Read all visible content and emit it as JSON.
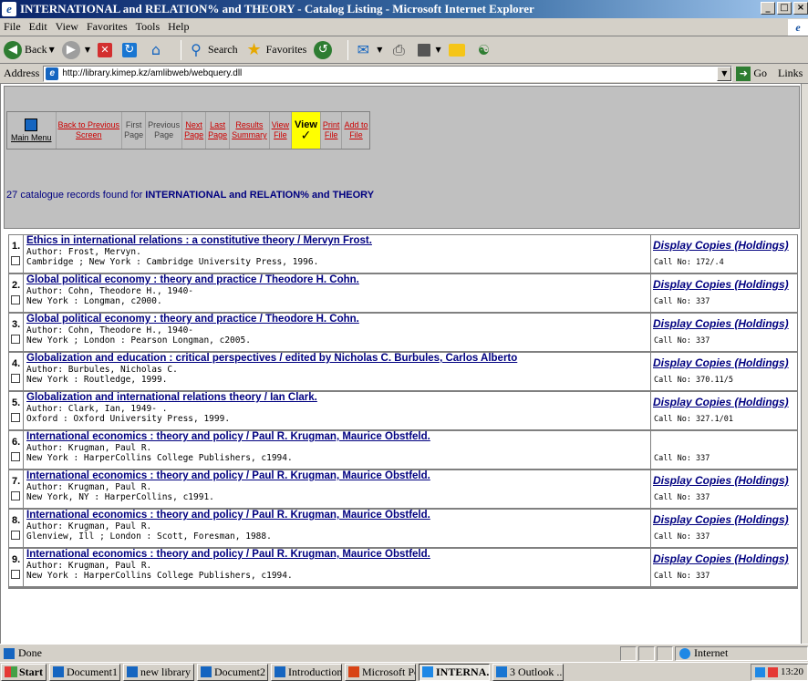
{
  "window": {
    "title": "INTERNATIONAL and RELATION% and THEORY - Catalog Listing - Microsoft Internet Explorer",
    "controls": [
      "_",
      "□",
      "×"
    ]
  },
  "menu": [
    "File",
    "Edit",
    "View",
    "Favorites",
    "Tools",
    "Help"
  ],
  "toolbar": {
    "back": "Back",
    "search": "Search",
    "favorites": "Favorites"
  },
  "address": {
    "label": "Address",
    "url": "http://library.kimep.kz/amlibweb/webquery.dll",
    "go": "Go",
    "links": "Links"
  },
  "nav": {
    "main_menu": "Main Menu",
    "back_previous": [
      "Back to Previous",
      "Screen"
    ],
    "first_page": [
      "First",
      "Page"
    ],
    "previous_page": [
      "Previous",
      "Page"
    ],
    "next_page": [
      "Next",
      "Page"
    ],
    "last_page": [
      "Last",
      "Page"
    ],
    "results_summary": [
      "Results",
      "Summary"
    ],
    "view_file": [
      "View",
      "File"
    ],
    "view_big": "View",
    "print_file": [
      "Print",
      "File"
    ],
    "add_to_file": [
      "Add to",
      "File"
    ]
  },
  "search": {
    "count": "27",
    "found_text": "catalogue records found for",
    "query": "INTERNATIONAL and RELATION% and THEORY"
  },
  "results": [
    {
      "num": "1.",
      "title": "Ethics in international relations : a constitutive theory / Mervyn Frost.",
      "author": "Author: Frost, Mervyn.",
      "pub": "Cambridge ; New York : Cambridge University Press, 1996.",
      "holdings": "Display Copies (Holdings)",
      "call": "Call No: 172/.4"
    },
    {
      "num": "2.",
      "title": "Global political economy : theory and practice / Theodore H. Cohn.",
      "author": "Author: Cohn, Theodore H., 1940-",
      "pub": "New York : Longman, c2000.",
      "holdings": "Display Copies (Holdings)",
      "call": "Call No: 337"
    },
    {
      "num": "3.",
      "title": "Global political economy : theory and practice / Theodore H. Cohn.",
      "author": "Author: Cohn, Theodore H., 1940-",
      "pub": "New York ; London : Pearson Longman, c2005.",
      "holdings": "Display Copies (Holdings)",
      "call": "Call No: 337"
    },
    {
      "num": "4.",
      "title": "Globalization and education : critical perspectives / edited by Nicholas C. Burbules, Carlos Alberto",
      "author": "Author: Burbules, Nicholas C.",
      "pub": "New York : Routledge, 1999.",
      "holdings": "Display Copies (Holdings)",
      "call": "Call No: 370.11/5"
    },
    {
      "num": "5.",
      "title": "Globalization and international relations theory / Ian Clark.",
      "author": "Author: Clark, Ian, 1949- .",
      "pub": "Oxford : Oxford University Press, 1999.",
      "holdings": "Display Copies (Holdings)",
      "call": "Call No: 327.1/01"
    },
    {
      "num": "6.",
      "title": "International economics : theory and policy / Paul R. Krugman, Maurice Obstfeld.",
      "author": "Author: Krugman, Paul R.",
      "pub": "New York : HarperCollins College Publishers, c1994.",
      "holdings": "",
      "call": "Call No: 337"
    },
    {
      "num": "7.",
      "title": "International economics : theory and policy / Paul R. Krugman, Maurice Obstfeld.",
      "author": "Author: Krugman, Paul R.",
      "pub": "New York, NY : HarperCollins, c1991.",
      "holdings": "Display Copies (Holdings)",
      "call": "Call No: 337"
    },
    {
      "num": "8.",
      "title": "International economics : theory and policy / Paul R. Krugman, Maurice Obstfeld.",
      "author": "Author: Krugman, Paul R.",
      "pub": "Glenview, Ill ; London : Scott, Foresman, 1988.",
      "holdings": "Display Copies (Holdings)",
      "call": "Call No: 337"
    },
    {
      "num": "9.",
      "title": "International economics : theory and policy / Paul R. Krugman, Maurice Obstfeld.",
      "author": "Author: Krugman, Paul R.",
      "pub": "New York : HarperCollins College Publishers, c1994.",
      "holdings": "Display Copies (Holdings)",
      "call": "Call No: 337"
    }
  ],
  "status": {
    "text": "Done",
    "zone": "Internet"
  },
  "taskbar": {
    "start": "Start",
    "tasks": [
      {
        "label": "Document1 ...",
        "icon": "word"
      },
      {
        "label": "new library ...",
        "icon": "word"
      },
      {
        "label": "Document2 ...",
        "icon": "word"
      },
      {
        "label": "Introduction ...",
        "icon": "word"
      },
      {
        "label": "Microsoft Po...",
        "icon": "ppt"
      },
      {
        "label": "INTERNA...",
        "icon": "ie",
        "active": true
      },
      {
        "label": "3 Outlook ...",
        "icon": "ol"
      }
    ],
    "clock": "13:20"
  }
}
